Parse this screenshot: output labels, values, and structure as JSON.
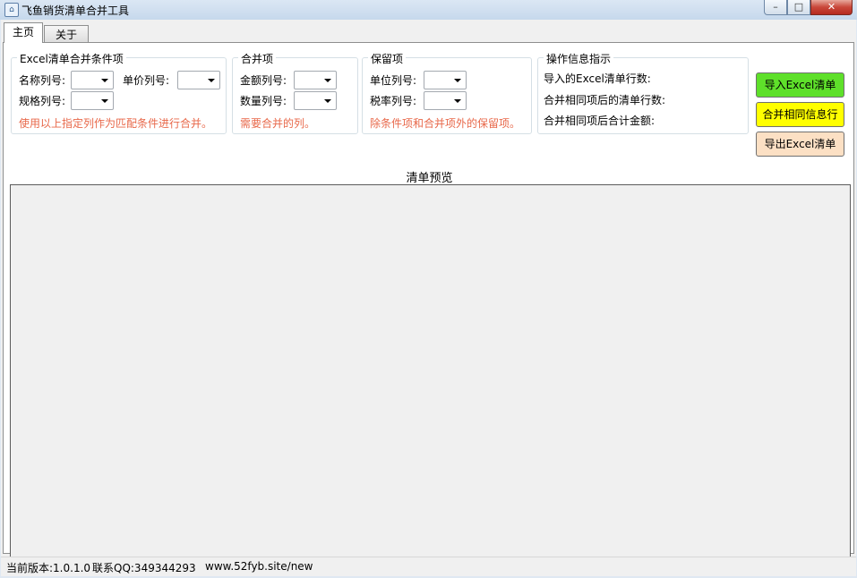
{
  "window": {
    "title": "飞鱼销货清单合并工具",
    "min_glyph": "–",
    "max_glyph": "□",
    "close_glyph": "✕"
  },
  "tabs": [
    {
      "label": "主页",
      "active": true
    },
    {
      "label": "关于",
      "active": false
    }
  ],
  "conditions": {
    "legend": "Excel清单合并条件项",
    "name_col": "名称列号:",
    "price_col": "单价列号:",
    "spec_col": "规格列号:",
    "hint": "使用以上指定列作为匹配条件进行合并。"
  },
  "merge": {
    "legend": "合并项",
    "amount_col": "金额列号:",
    "qty_col": "数量列号:",
    "hint": "需要合并的列。"
  },
  "keep": {
    "legend": "保留项",
    "unit_col": "单位列号:",
    "tax_col": "税率列号:",
    "hint": "除条件项和合并项外的保留项。"
  },
  "info": {
    "legend": "操作信息指示",
    "imported_rows": "导入的Excel清单行数:",
    "merged_rows": "合并相同项后的清单行数:",
    "total_amount": "合并相同项后合计金额:"
  },
  "buttons": {
    "import": "导入Excel清单",
    "merge": "合并相同信息行",
    "export": "导出Excel清单"
  },
  "preview": {
    "title": "清单预览"
  },
  "status": {
    "version": "当前版本:1.0.1.0",
    "qq": "联系QQ:349344293",
    "site": "www.52fyb.site/new"
  },
  "colors": {
    "import_button": "#5ee02a",
    "merge_button": "#ffff00",
    "export_button": "#fce0c4",
    "hint_text": "#e8684a"
  }
}
